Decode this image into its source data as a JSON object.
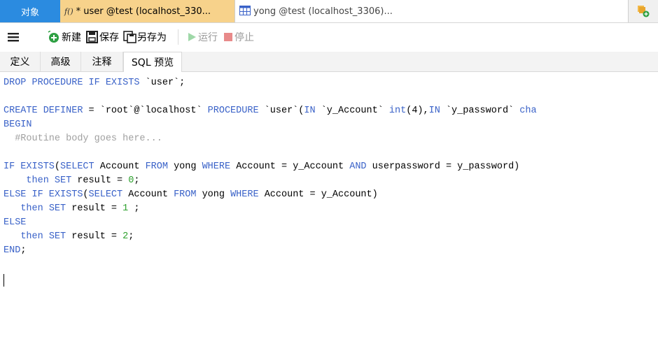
{
  "tabs": {
    "objects": "对象",
    "routine": "* user @test (localhost_330...",
    "table": "yong @test (localhost_3306)..."
  },
  "toolbar": {
    "new": "新建",
    "save": "保存",
    "save_as": "另存为",
    "run": "运行",
    "stop": "停止"
  },
  "subtabs": [
    "定义",
    "高级",
    "注释",
    "SQL 预览"
  ],
  "code": {
    "l1": "`user`;",
    "l2a": " = `root`@`localhost` ",
    "l2b": " `user`(",
    "l2c": " `y_Account` ",
    "l2d": "(4),",
    "l2e": " `y_password` ",
    "l2f": "cha",
    "l3": "#Routine body goes here...",
    "l4a": " Account ",
    "l4b": " yong ",
    "l4c": " Account = y_Account ",
    "l4d": " userpassword = y_password)",
    "l5a": " result = ",
    "l5b": "0",
    "l6a": " Account ",
    "l6b": " yong ",
    "l6c": " Account = y_Account)",
    "l7a": " result = ",
    "l7b": "1",
    "l9a": " result = ",
    "l9b": "2"
  }
}
